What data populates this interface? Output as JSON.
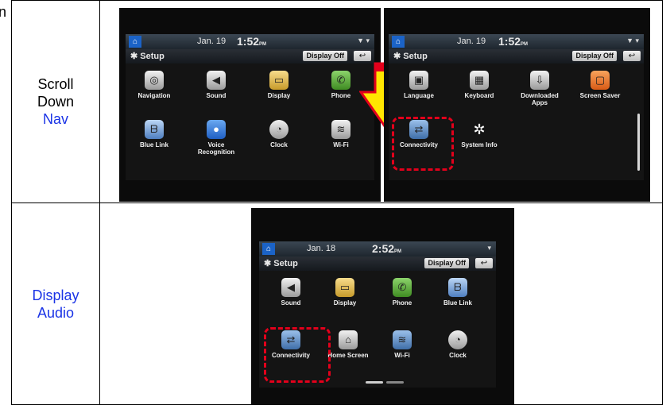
{
  "clipped_text": "n",
  "row1": {
    "label_line1": "Scroll",
    "label_line2": "Down",
    "label_line3": "Nav"
  },
  "row2": {
    "label_line1": "Display",
    "label_line2": "Audio"
  },
  "screen_a": {
    "date": "Jan. 19",
    "time": "1:52",
    "ampm": "PM",
    "setup": "Setup",
    "display_off": "Display Off",
    "items": [
      "Navigation",
      "Sound",
      "Display",
      "Phone",
      "Blue Link",
      "Voice Recognition",
      "Clock",
      "Wi-Fi"
    ],
    "icons": [
      "navigation-icon",
      "sound-icon",
      "display-icon",
      "phone-icon",
      "blue-link-icon",
      "voice-recognition-icon",
      "clock-icon",
      "wifi-icon"
    ]
  },
  "screen_b": {
    "date": "Jan. 19",
    "time": "1:52",
    "ampm": "PM",
    "setup": "Setup",
    "display_off": "Display Off",
    "items": [
      "Language",
      "Keyboard",
      "Downloaded Apps",
      "Screen Saver",
      "Connectivity",
      "System Info"
    ],
    "icons": [
      "language-icon",
      "keyboard-icon",
      "downloaded-apps-icon",
      "screen-saver-icon",
      "connectivity-icon",
      "system-info-icon"
    ]
  },
  "screen_c": {
    "date": "Jan. 18",
    "time": "2:52",
    "ampm": "PM",
    "setup": "Setup",
    "display_off": "Display Off",
    "items": [
      "Sound",
      "Display",
      "Phone",
      "Blue Link",
      "Connectivity",
      "Home Screen",
      "Wi-Fi",
      "Clock"
    ],
    "icons": [
      "sound-icon",
      "display-icon",
      "phone-icon",
      "blue-link-icon",
      "connectivity-icon",
      "home-screen-icon",
      "wifi-icon",
      "clock-icon"
    ]
  },
  "colors": {
    "label_blue": "#1a33e6",
    "highlight_red": "#e3001b",
    "arrow_yellow": "#ffe600",
    "arrow_red": "#e3001b"
  }
}
